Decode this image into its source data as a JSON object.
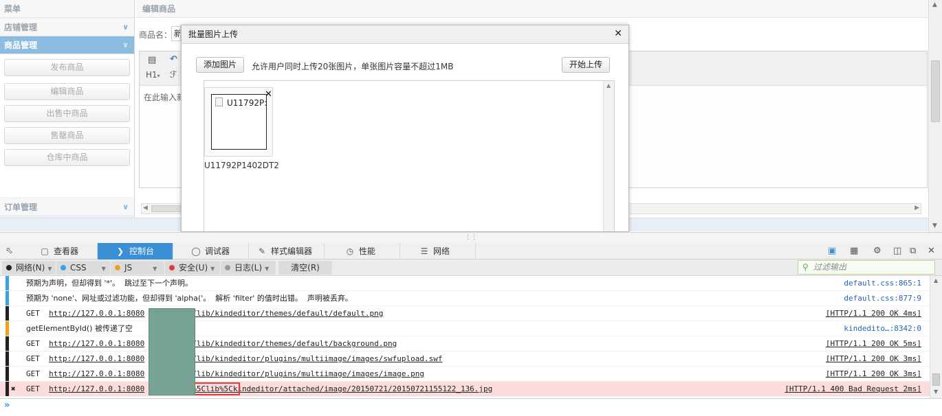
{
  "sidebar": {
    "header": "菜单",
    "sections": [
      {
        "label": "店铺管理",
        "icon": "chevron-down-icon"
      },
      {
        "label": "商品管理",
        "icon": "chevron-down-icon",
        "active": true
      },
      {
        "label": "订单管理",
        "icon": "chevron-down-icon"
      }
    ],
    "items": [
      "发布商品",
      "编辑商品",
      "出售中商品",
      "售罄商品",
      "仓库中商品"
    ]
  },
  "main": {
    "title": "编辑商品",
    "name_label": "商品名：",
    "name_value": "新",
    "heading_button": "H1",
    "editor_placeholder": "在此输入新"
  },
  "dialog": {
    "title": "批量图片上传",
    "add_button": "添加图片",
    "hint": "允许用户同时上传20张图片，单张图片容量不超过1MB",
    "start_button": "开始上传",
    "file": {
      "thumb_text": "U11792P:",
      "caption": "U11792P1402DT2"
    }
  },
  "devtools": {
    "tabs": [
      {
        "label": "查看器",
        "icon": "inspector-icon"
      },
      {
        "label": "控制台",
        "icon": "console-icon",
        "active": true
      },
      {
        "label": "调试器",
        "icon": "debugger-icon"
      },
      {
        "label": "样式编辑器",
        "icon": "style-editor-icon"
      },
      {
        "label": "性能",
        "icon": "performance-icon"
      },
      {
        "label": "网络",
        "icon": "network-icon"
      }
    ],
    "filters": [
      {
        "label": "网络(N)",
        "color": "#222222"
      },
      {
        "label": "CSS",
        "color": "#3aa3e3"
      },
      {
        "label": "JS",
        "color": "#f0a020"
      },
      {
        "label": "安全(U)",
        "color": "#e03c3c"
      },
      {
        "label": "日志(L)",
        "color": "#9a9a9a"
      }
    ],
    "clear_button": "清空(R)",
    "filter_placeholder": "过滤输出",
    "logs": [
      {
        "type": "css-warn",
        "text": "预期为声明，但却得到 '*'。  跳过至下一个声明。",
        "source": "default.css:865:1"
      },
      {
        "type": "css-warn",
        "text": "预期为 'none'、网址或过滤功能，但却得到 'alpha('。  解析 'filter' 的值时出错。  声明被丢弃。",
        "source": "default.css:877:9"
      },
      {
        "type": "net",
        "method": "GET",
        "url_host": "http://127.0.0.1:8080",
        "url_path": "/lib/kindeditor/themes/default/default.png",
        "status": "[HTTP/1.1 200 OK 4ms]"
      },
      {
        "type": "js-warn",
        "text": "getElementById() 被传递了空",
        "source": "kindedito…:8342:0"
      },
      {
        "type": "net",
        "method": "GET",
        "url_host": "http://127.0.0.1:8080",
        "url_path": "/lib/kindeditor/themes/default/background.png",
        "status": "[HTTP/1.1 200 OK 5ms]"
      },
      {
        "type": "net",
        "method": "GET",
        "url_host": "http://127.0.0.1:8080",
        "url_path": "/lib/kindeditor/plugins/multiimage/images/swfupload.swf",
        "status": "[HTTP/1.1 200 OK 3ms]"
      },
      {
        "type": "net",
        "method": "GET",
        "url_host": "http://127.0.0.1:8080",
        "url_path": "/lib/kindeditor/plugins/multiimage/images/image.png",
        "status": "[HTTP/1.1 200 OK 3ms]"
      },
      {
        "type": "net-error",
        "method": "GET",
        "url_host": "http://127.0.0.1:8080",
        "url_highlight": "%5Clib%5C",
        "url_path": "kindeditor/attached/image/20150721/20150721155122_136.jpg",
        "status": "[HTTP/1.1 400 Bad Request 2ms]"
      }
    ]
  }
}
